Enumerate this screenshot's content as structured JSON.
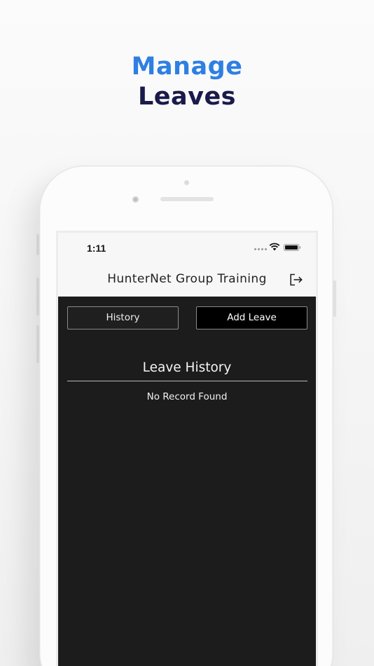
{
  "promo": {
    "line1": "Manage",
    "line2": "Leaves"
  },
  "status_bar": {
    "time": "1:11"
  },
  "nav": {
    "title": "HunterNet Group Training",
    "logout_icon": "logout-icon"
  },
  "actions": {
    "history_label": "History",
    "add_leave_label": "Add Leave"
  },
  "section": {
    "title": "Leave History",
    "empty_message": "No Record Found"
  },
  "colors": {
    "promo_line1": "#2f7fe3",
    "promo_line2": "#1a1a4b",
    "content_bg": "#1c1c1c"
  }
}
